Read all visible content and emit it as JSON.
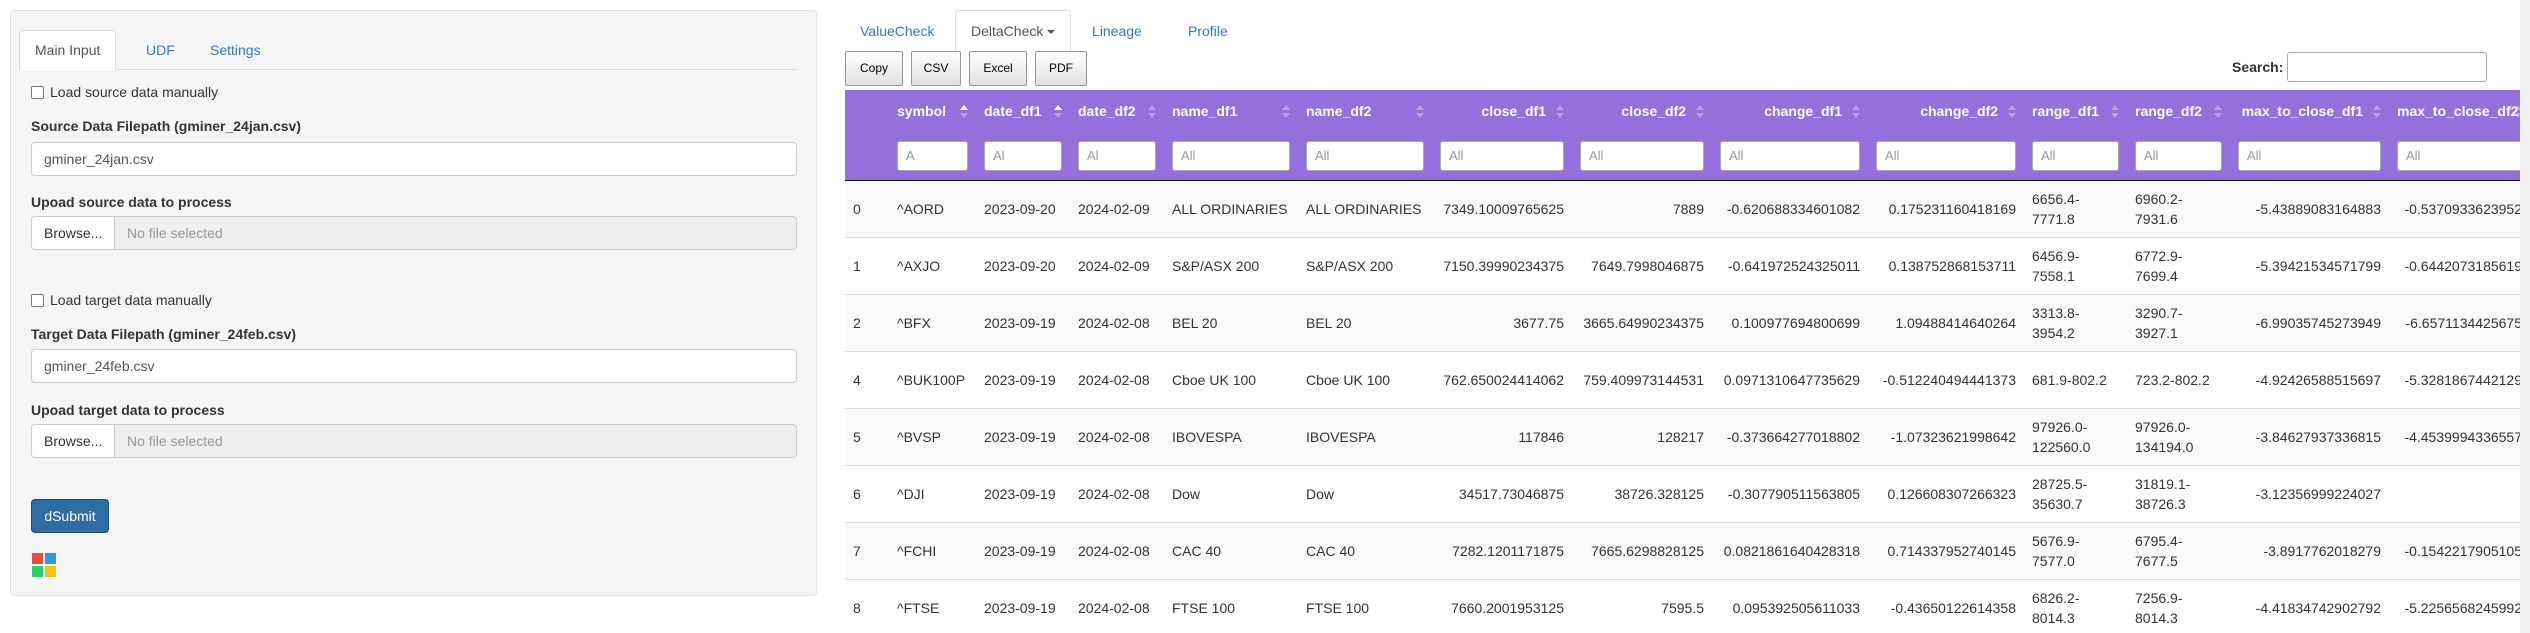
{
  "left_tabs": [
    "Main Input",
    "UDF",
    "Settings"
  ],
  "source": {
    "manual_label": "Load source data manually",
    "filepath_label": "Source Data Filepath (gminer_24jan.csv)",
    "filepath_value": "gminer_24jan.csv",
    "upload_label": "Upoad source data to process",
    "browse_label": "Browse...",
    "file_status": "No file selected"
  },
  "target": {
    "manual_label": "Load target data manually",
    "filepath_label": "Target Data Filepath (gminer_24feb.csv)",
    "filepath_value": "gminer_24feb.csv",
    "upload_label": "Upoad target data to process",
    "browse_label": "Browse...",
    "file_status": "No file selected"
  },
  "submit_label": "dSubmit",
  "right_tabs": [
    "ValueCheck",
    "DeltaCheck",
    "Lineage",
    "Profile"
  ],
  "buttons": [
    "Copy",
    "CSV",
    "Excel",
    "PDF"
  ],
  "search_label": "Search:",
  "table": {
    "columns": [
      "",
      "symbol",
      "date_df1",
      "date_df2",
      "name_df1",
      "name_df2",
      "close_df1",
      "close_df2",
      "change_df1",
      "change_df2",
      "range_df1",
      "range_df2",
      "max_to_close_df1",
      "max_to_close_df2"
    ],
    "filters": [
      "",
      "A",
      "Al",
      "Al",
      "All",
      "All",
      "All",
      "All",
      "All",
      "All",
      "All",
      "All",
      "All",
      "All"
    ],
    "rows": [
      [
        "0",
        "^AORD",
        "2023-09-20",
        "2024-02-09",
        "ALL ORDINARIES",
        "ALL ORDINARIES",
        "7349.10009765625",
        "7889",
        "-0.620688334601082",
        "0.175231160418169",
        "6656.4-7771.8",
        "6960.2-7931.6",
        "-5.43889083164883",
        "-0.5370933623952"
      ],
      [
        "1",
        "^AXJO",
        "2023-09-20",
        "2024-02-09",
        "S&P/ASX 200",
        "S&P/ASX 200",
        "7150.39990234375",
        "7649.7998046875",
        "-0.641972524325011",
        "0.138752868153711",
        "6456.9-7558.1",
        "6772.9-7699.4",
        "-5.39421534571799",
        "-0.6442073185619"
      ],
      [
        "2",
        "^BFX",
        "2023-09-19",
        "2024-02-08",
        "BEL 20",
        "BEL 20",
        "3677.75",
        "3665.64990234375",
        "0.100977694800699",
        "1.09488414640264",
        "3313.8-3954.2",
        "3290.7-3927.1",
        "-6.99035745273949",
        "-6.6571134425675"
      ],
      [
        "4",
        "^BUK100P",
        "2023-09-19",
        "2024-02-08",
        "Cboe UK 100",
        "Cboe UK 100",
        "762.650024414062",
        "759.409973144531",
        "0.0971310647735629",
        "-0.512240494441373",
        "681.9-802.2",
        "723.2-802.2",
        "-4.92426588515697",
        "-5.3281867442129"
      ],
      [
        "5",
        "^BVSP",
        "2023-09-19",
        "2024-02-08",
        "IBOVESPA",
        "IBOVESPA",
        "117846",
        "128217",
        "-0.373664277018802",
        "-1.07323621998642",
        "97926.0-122560.0",
        "97926.0-134194.0",
        "-3.84627937336815",
        "-4.4539994336557"
      ],
      [
        "6",
        "^DJI",
        "2023-09-19",
        "2024-02-08",
        "Dow",
        "Dow",
        "34517.73046875",
        "38726.328125",
        "-0.307790511563805",
        "0.126608307266323",
        "28725.5-35630.7",
        "31819.1-38726.3",
        "-3.12356999224027",
        ""
      ],
      [
        "7",
        "^FCHI",
        "2023-09-19",
        "2024-02-08",
        "CAC 40",
        "CAC 40",
        "7282.1201171875",
        "7665.6298828125",
        "0.0821861640428318",
        "0.714337952740145",
        "5676.9-7577.0",
        "6795.4-7677.5",
        "-3.8917762018279",
        "-0.1542217905105"
      ],
      [
        "8",
        "^FTSE",
        "2023-09-19",
        "2024-02-08",
        "FTSE 100",
        "FTSE 100",
        "7660.2001953125",
        "7595.5",
        "0.095392505611033",
        "-0.43650122614358",
        "6826.2-8014.3",
        "7256.9-8014.3",
        "-4.41834742902792",
        "-5.2256568245992"
      ]
    ]
  }
}
